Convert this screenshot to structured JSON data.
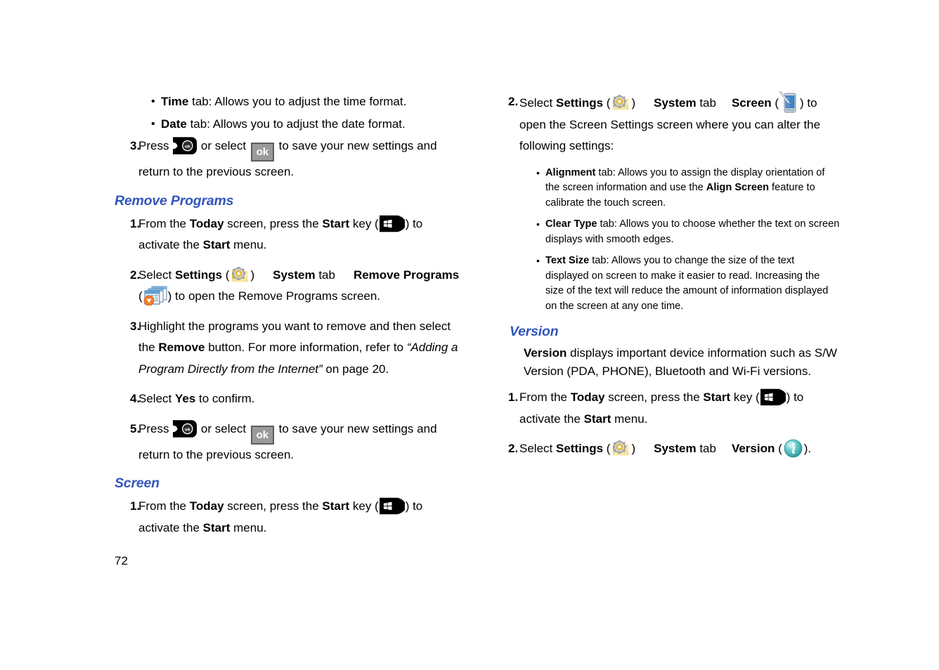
{
  "document": {
    "page_number": "72",
    "heading_color": "#3355bb"
  },
  "left_column": {
    "bullets_top": [
      {
        "term": "Time",
        "text": " tab: Allows you to adjust the time format."
      },
      {
        "term": "Date",
        "text": " tab: Allows you to adjust the date format."
      }
    ],
    "step3_clock": {
      "num": "3.",
      "t1": "Press ",
      "t2": " or select ",
      "ok_label": "ok",
      "t3": " to save your new settings and return to the previous screen."
    },
    "remove_programs": {
      "heading": "Remove Programs",
      "step1": {
        "num": "1.",
        "t1": "From the ",
        "b1": "Today",
        "t2": " screen, press the ",
        "b2": "Start",
        "t3": " key (",
        "t4": ") to activate the ",
        "b3": "Start",
        "t5": " menu."
      },
      "step2": {
        "num": "2.",
        "t1": "Select ",
        "b1": "Settings",
        "t2": " (",
        "t3": ")",
        "b2": "System",
        "t4": " tab",
        "b3": "Remove Programs",
        "t5": "(",
        "t6": ") to open the Remove Programs screen."
      },
      "step3": {
        "num": "3.",
        "t1": "Highlight the programs you want to remove and then select the ",
        "b1": "Remove",
        "t2": " button. For more information, refer to ",
        "i1": "“Adding a Program Directly from the Internet”",
        "t3": "  on page 20."
      },
      "step4": {
        "num": "4.",
        "t1": "Select ",
        "b1": "Yes",
        "t2": " to confirm."
      },
      "step5": {
        "num": "5.",
        "t1": "Press ",
        "t2": " or select ",
        "ok_label": "ok",
        "t3": " to save your new settings and return to the previous screen."
      }
    },
    "screen": {
      "heading": "Screen",
      "step1": {
        "num": "1.",
        "t1": "From the ",
        "b1": "Today",
        "t2": " screen, press the ",
        "b2": "Start",
        "t3": " key (",
        "t4": ") to activate the ",
        "b3": "Start",
        "t5": " menu."
      }
    }
  },
  "right_column": {
    "screen_step2": {
      "num": "2.",
      "t1": "Select ",
      "b1": "Settings",
      "t2": " (",
      "t3": ")",
      "b2": "System",
      "t4": " tab",
      "b3": "Screen",
      "t5": " (",
      "t6": ") to open the Screen Settings screen where you can alter the following settings:"
    },
    "screen_bullets": [
      {
        "term": "Alignment",
        "t1": " tab: Allows you to assign the display orientation of the screen information and use the ",
        "b1": "Align Screen",
        "t2": " feature to calibrate the touch screen."
      },
      {
        "term": "Clear Type",
        "t1": " tab: Allows you to choose whether the text on screen displays with smooth edges.",
        "b1": "",
        "t2": ""
      },
      {
        "term": "Text Size",
        "t1": " tab: Allows you to change the size of the text displayed on screen to make it easier to read. Increasing the size of the text will reduce the amount of information displayed on the screen at any one time.",
        "b1": "",
        "t2": ""
      }
    ],
    "version": {
      "heading": "Version",
      "intro_bold": "Version",
      "intro_text": " displays important device information such as S/W Version (PDA, PHONE), Bluetooth and Wi-Fi versions.",
      "step1": {
        "num": "1.",
        "t1": "From the ",
        "b1": "Today",
        "t2": " screen, press the ",
        "b2": "Start",
        "t3": " key (",
        "t4": ") to activate the ",
        "b3": "Start",
        "t5": " menu."
      },
      "step2": {
        "num": "2.",
        "t1": "Select ",
        "b1": "Settings",
        "t2": " (",
        "t3": ")",
        "b2": "System",
        "t4": " tab",
        "b3": "Version",
        "t5": " (",
        "t6": ")."
      }
    }
  },
  "icons": {
    "start_key": "start-key-icon",
    "ok_key": "ok-hardware-key-icon",
    "ok_soft": "ok-soft-button-icon",
    "settings": "settings-folder-gear-icon",
    "remove_programs": "remove-programs-icon",
    "screen_device": "pda-stylus-icon",
    "version_info": "info-circle-icon"
  }
}
